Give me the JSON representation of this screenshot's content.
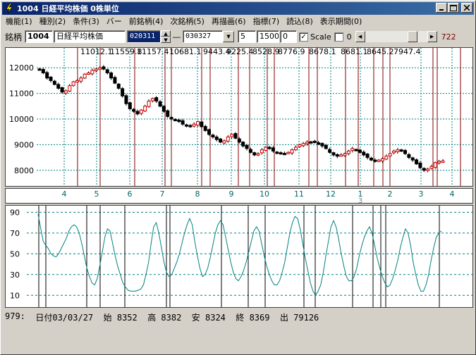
{
  "window": {
    "title": "1004 日経平均株価 0株単位"
  },
  "menu": [
    {
      "id": "kinou",
      "label": "機能(1)"
    },
    {
      "id": "shubetsu",
      "label": "種別(2)"
    },
    {
      "id": "jouken",
      "label": "条件(3)"
    },
    {
      "id": "bar",
      "label": "バー"
    },
    {
      "id": "prev",
      "label": "前銘柄(4)"
    },
    {
      "id": "next",
      "label": "次銘柄(5)"
    },
    {
      "id": "redraw",
      "label": "再描画(6)"
    },
    {
      "id": "indicator",
      "label": "指標(7)"
    },
    {
      "id": "load",
      "label": "読込(8)"
    },
    {
      "id": "period",
      "label": "表示期間(0)"
    }
  ],
  "toolbar": {
    "label": "銘柄",
    "code": "1004",
    "name": "日経平均株価",
    "date_from": "020311",
    "dash": "―",
    "date_to": "030327",
    "param1": "5",
    "param2": "1500",
    "param3": "0",
    "scale_label": "Scale",
    "scale_value": "0",
    "count": "722"
  },
  "status": {
    "index": "979:",
    "date": "日付03/03/27",
    "open": "始 8352",
    "high": "高 8382",
    "low": "安 8324",
    "close": "終 8369",
    "volume": "出 79126"
  },
  "chart_data": [
    {
      "type": "candlestick",
      "ylim": [
        7500,
        12500
      ],
      "yticks": [
        8000,
        9000,
        10000,
        11000,
        12000
      ],
      "grid": true,
      "up_color": "#cc0000",
      "down_color": "#000000",
      "top_labels": [
        "11012.1",
        "11559.8",
        "11157.4",
        "10681.1",
        "9443.4",
        "9225.4",
        "8528.9",
        "8776.9",
        "8678.1",
        "8681.1",
        "8645.2",
        "7947.4"
      ],
      "close_series": [
        11950,
        11800,
        11600,
        11500,
        11350,
        11200,
        11050,
        11100,
        11300,
        11450,
        11500,
        11600,
        11750,
        11800,
        11900,
        11950,
        12000,
        11950,
        11800,
        11600,
        11400,
        11200,
        10900,
        10600,
        10400,
        10300,
        10200,
        10350,
        10500,
        10700,
        10800,
        10700,
        10500,
        10300,
        10100,
        10000,
        9950,
        9900,
        9800,
        9750,
        9700,
        9800,
        9900,
        9700,
        9550,
        9400,
        9300,
        9200,
        9100,
        9150,
        9300,
        9400,
        9250,
        9100,
        8950,
        8850,
        8700,
        8600,
        8650,
        8800,
        8900,
        8850,
        8750,
        8700,
        8650,
        8650,
        8700,
        8800,
        8900,
        9000,
        9050,
        9100,
        9100,
        9100,
        9050,
        8950,
        8850,
        8700,
        8600,
        8550,
        8600,
        8650,
        8750,
        8850,
        8800,
        8700,
        8600,
        8500,
        8400,
        8350,
        8400,
        8450,
        8550,
        8650,
        8750,
        8800,
        8750,
        8650,
        8500,
        8400,
        8250,
        8100,
        8000,
        8050,
        8150,
        8300,
        8350,
        8369
      ]
    },
    {
      "type": "line",
      "ylim": [
        0,
        95
      ],
      "yticks": [
        10,
        30,
        50,
        70,
        90
      ],
      "grid": true,
      "color": "#00807f",
      "values": [
        88,
        75,
        62,
        58,
        55,
        50,
        48,
        47,
        50,
        55,
        60,
        65,
        72,
        76,
        78,
        76,
        70,
        60,
        48,
        36,
        28,
        22,
        20,
        26,
        38,
        52,
        66,
        74,
        72,
        60,
        48,
        38,
        30,
        22,
        18,
        15,
        14,
        14,
        14,
        15,
        16,
        20,
        30,
        42,
        60,
        76,
        80,
        70,
        56,
        42,
        32,
        28,
        30,
        36,
        42,
        50,
        60,
        70,
        78,
        84,
        78,
        62,
        48,
        36,
        28,
        30,
        36,
        46,
        58,
        70,
        78,
        82,
        78,
        66,
        54,
        42,
        32,
        26,
        24,
        28,
        34,
        42,
        52,
        62,
        72,
        76,
        72,
        60,
        48,
        38,
        30,
        24,
        20,
        20,
        24,
        32,
        42,
        56,
        70,
        80,
        86,
        84,
        74,
        60,
        46,
        34,
        22,
        14,
        10,
        14,
        20,
        32,
        48,
        62,
        76,
        82,
        76,
        64,
        50,
        38,
        28,
        24,
        24,
        28,
        36,
        48,
        58,
        66,
        72,
        76,
        70,
        58,
        46,
        36,
        28,
        22,
        18,
        20,
        26,
        34,
        44,
        56,
        66,
        74,
        70,
        58,
        42,
        30,
        20,
        14,
        14,
        20,
        30,
        44,
        56,
        66,
        70,
        72
      ]
    }
  ],
  "markers": {
    "top_xlabels": [
      "4",
      "5",
      "6",
      "7",
      "8",
      "9",
      "10",
      "11",
      "12",
      "1",
      "2",
      "3",
      "4"
    ],
    "year_marker": "3"
  },
  "colors": {
    "title_start": "#0a246a",
    "title_end": "#3a6ea5",
    "grid": "#008080",
    "axis_labels": "#006666",
    "vline": "#800000"
  }
}
